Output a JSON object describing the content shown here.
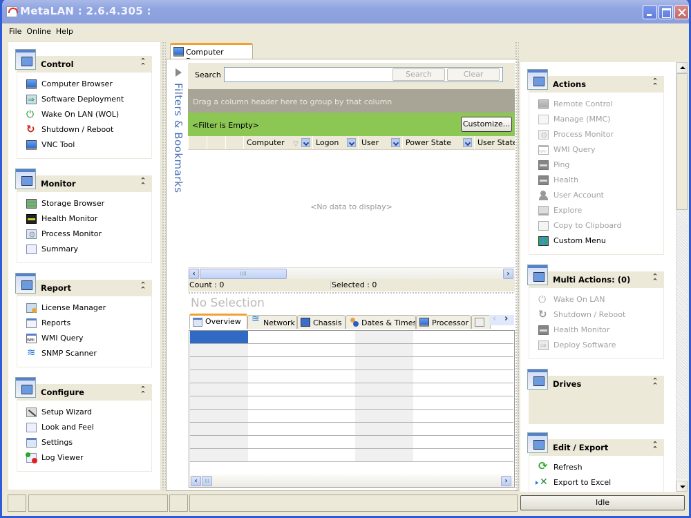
{
  "window": {
    "title": "MetaLAN : 2.6.4.305 :"
  },
  "menu": [
    "File",
    "Online",
    "Help"
  ],
  "left_pane": {
    "groups": [
      {
        "title": "Control",
        "items": [
          "Computer Browser",
          "Software Deployment",
          "Wake On LAN (WOL)",
          "Shutdown / Reboot",
          "VNC Tool"
        ]
      },
      {
        "title": "Monitor",
        "items": [
          "Storage Browser",
          "Health Monitor",
          "Process Monitor",
          "Summary"
        ]
      },
      {
        "title": "Report",
        "items": [
          "License Manager",
          "Reports",
          "WMI Query",
          "SNMP Scanner"
        ]
      },
      {
        "title": "Configure",
        "items": [
          "Setup Wizard",
          "Look and Feel",
          "Settings",
          "Log Viewer"
        ]
      }
    ]
  },
  "document_tab": "Computer Browser",
  "filters_bar": "Filters & Bookmarks",
  "search": {
    "label": "Search",
    "value": "",
    "search_button": "Search",
    "clear_button": "Clear"
  },
  "grid": {
    "group_prompt": "Drag a column header here to group by that column",
    "filter_text": "<Filter is Empty>",
    "customize_button": "Customize...",
    "columns": [
      "Computer",
      "Logon",
      "User",
      "Power State",
      "User State"
    ],
    "empty_text": "<No data to display>",
    "count": "Count : 0",
    "selected": "Selected : 0"
  },
  "details": {
    "no_selection": "No Selection",
    "tabs": [
      "Overview",
      "Network",
      "Chassis",
      "Dates & Times",
      "Processor"
    ],
    "active_tab": "Overview"
  },
  "right_pane": {
    "actions": {
      "title": "Actions",
      "items": [
        {
          "label": "Remote Control",
          "enabled": false
        },
        {
          "label": "Manage (MMC)",
          "enabled": false
        },
        {
          "label": "Process Monitor",
          "enabled": false
        },
        {
          "label": "WMI Query",
          "enabled": false
        },
        {
          "label": "Ping",
          "enabled": false
        },
        {
          "label": "Health",
          "enabled": false
        },
        {
          "label": "User Account",
          "enabled": false
        },
        {
          "label": "Explore",
          "enabled": false
        },
        {
          "label": "Copy to Clipboard",
          "enabled": false
        },
        {
          "label": "Custom Menu",
          "enabled": true
        }
      ]
    },
    "multi_actions": {
      "title": "Multi Actions: (0)",
      "items": [
        {
          "label": "Wake On LAN",
          "enabled": false
        },
        {
          "label": "Shutdown / Reboot",
          "enabled": false
        },
        {
          "label": "Health Monitor",
          "enabled": false
        },
        {
          "label": "Deploy Software",
          "enabled": false
        }
      ]
    },
    "drives": {
      "title": "Drives"
    },
    "edit_export": {
      "title": "Edit / Export",
      "items": [
        {
          "label": "Refresh",
          "enabled": true
        },
        {
          "label": "Export to Excel",
          "enabled": true
        }
      ]
    }
  },
  "status_bar": {
    "state": "Idle"
  }
}
